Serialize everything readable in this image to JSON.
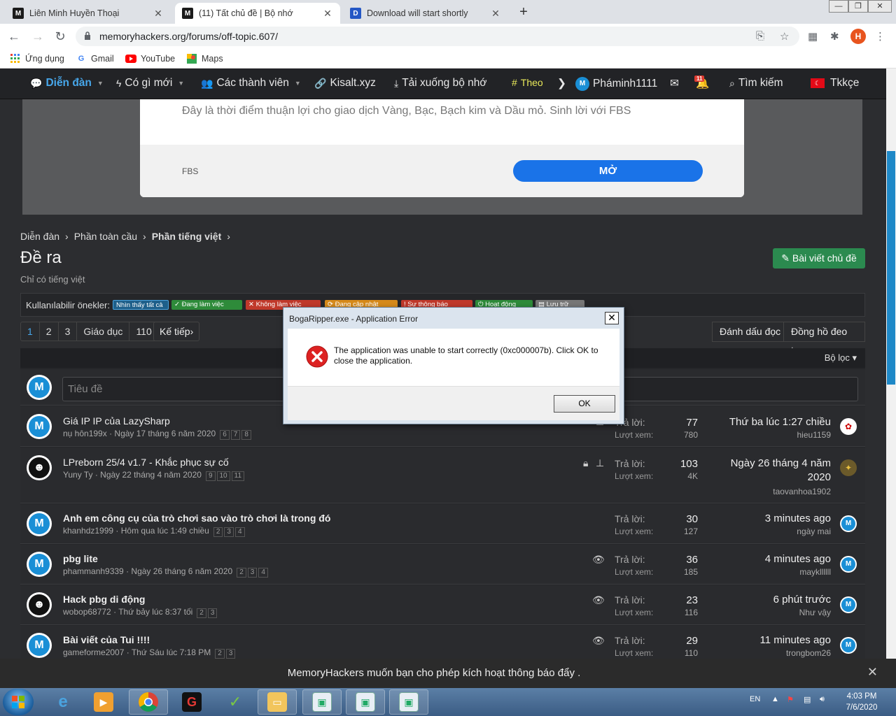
{
  "browser": {
    "tabs": [
      {
        "title": "Liên Minh Huyền Thoại",
        "favicon": "M"
      },
      {
        "title": "(11) Tất chủ đề | Bộ nhớ",
        "favicon": "M"
      },
      {
        "title": "Download will start shortly",
        "favicon": "D"
      }
    ],
    "url": "memoryhackers.org/forums/off-topic.607/",
    "profile_initial": "H",
    "bookmarks": [
      "Ứng dụng",
      "Gmail",
      "YouTube",
      "Maps"
    ]
  },
  "nav": {
    "items": [
      "Diễn đàn",
      "Có gì mới",
      "Các thành viên",
      "Kisalt.xyz",
      "Tải xuống bộ nhớ",
      "Theo"
    ],
    "user": "Pháminh1111",
    "notif_count": "11",
    "search": "Tìm kiếm",
    "lang": "Tkkçe"
  },
  "ad": {
    "text": "Đây là thời điểm thuận lợi cho giao dịch Vàng, Bạc, Bạch kim và Dầu mỏ. Sinh lời với FBS",
    "source": "FBS",
    "button": "MỞ"
  },
  "breadcrumb": [
    "Diễn đàn",
    "Phần toàn cầu",
    "Phần tiếng việt"
  ],
  "page": {
    "title": "Đề ra",
    "description": "Chỉ có tiếng việt",
    "new_thread_button": "Bài viết chủ đề"
  },
  "prefixes": {
    "label": "Kullanılabilir önekler:",
    "items": [
      {
        "text": "Nhìn thấy tất cả",
        "color": "#1e5f8a"
      },
      {
        "text": "Đang làm việc",
        "color": "#2e8b3a"
      },
      {
        "text": "Không làm việc",
        "color": "#c0392b"
      },
      {
        "text": "Đang cập nhật",
        "color": "#d68a1a"
      },
      {
        "text": "Sự thông báo",
        "color": "#c0392b"
      },
      {
        "text": "Hoạt động",
        "color": "#2e8b3a"
      },
      {
        "text": "Lưu trữ",
        "color": "#777777"
      }
    ]
  },
  "pager": {
    "pages": [
      "1",
      "2",
      "3",
      "Giáo dục",
      "110"
    ],
    "next": "Kế tiếp",
    "mark_read": "Đánh dấu đọc",
    "watch": "Đồng hồ đeo tay"
  },
  "filter": "Bộ lọc",
  "title_placeholder": "Tiêu đề",
  "threads": [
    {
      "title": "Giá IP IP của LazySharp",
      "author": "nụ hôn199x",
      "date": "Ngày 17 tháng 6 năm 2020",
      "pages": [
        "6",
        "7",
        "8"
      ],
      "replies_label": "Trả lời:",
      "replies": "77",
      "views_label": "Lượt xem:",
      "views": "780",
      "last_time": "Thứ ba lúc 1:27 chiều",
      "last_user": "hieu1159"
    },
    {
      "title": "LPreborn 25/4 v1.7 - Khắc phục sự cố",
      "author": "Yuny Ty",
      "date": "Ngày 22 tháng 4 năm 2020",
      "pages": [
        "9",
        "10",
        "11"
      ],
      "replies_label": "Trả lời:",
      "replies": "103",
      "views_label": "Lượt xem:",
      "views": "4K",
      "last_time": "Ngày 26 tháng 4 năm",
      "last_time2": "2020",
      "last_user": "taovanhoa1902"
    },
    {
      "title": "Anh em công cụ của trò chơi sao vào trò chơi là trong đó",
      "author": "khanhdz1999",
      "date": "Hôm qua lúc 1:49 chiều",
      "pages": [
        "2",
        "3",
        "4"
      ],
      "replies_label": "Trả lời:",
      "replies": "30",
      "views_label": "Lượt xem:",
      "views": "127",
      "last_time": "3 minutes ago",
      "last_user": "ngày mai"
    },
    {
      "title": "pbg lite",
      "author": "phammanh9339",
      "date": "Ngày 26 tháng 6 năm 2020",
      "pages": [
        "2",
        "3",
        "4"
      ],
      "replies_label": "Trả lời:",
      "replies": "36",
      "views_label": "Lượt xem:",
      "views": "185",
      "last_time": "4 minutes ago",
      "last_user": "maykllllll"
    },
    {
      "title": "Hack pbg di động",
      "author": "wobop68772",
      "date": "Thứ bảy lúc 8:37 tối",
      "pages": [
        "2",
        "3"
      ],
      "replies_label": "Trả lời:",
      "replies": "23",
      "views_label": "Lượt xem:",
      "views": "116",
      "last_time": "6 phút trước",
      "last_user": "Như vậy"
    },
    {
      "title": "Bài viết của Tui !!!!",
      "author": "gameforme2007",
      "date": "Thứ Sáu lúc 7:18 PM",
      "pages": [
        "2",
        "3"
      ],
      "replies_label": "Trả lời:",
      "replies": "29",
      "views_label": "Lượt xem:",
      "views": "110",
      "last_time": "11 minutes ago",
      "last_user": "trongbom26"
    }
  ],
  "push_notice": "MemoryHackers muốn bạn cho phép kích hoạt thông báo đẩy .",
  "dialog": {
    "title": "BogaRipper.exe - Application Error",
    "message": "The application was unable to start correctly (0xc000007b). Click OK to close the application.",
    "ok": "OK"
  },
  "taskbar": {
    "lang": "EN",
    "time": "4:03 PM",
    "date": "7/6/2020"
  }
}
